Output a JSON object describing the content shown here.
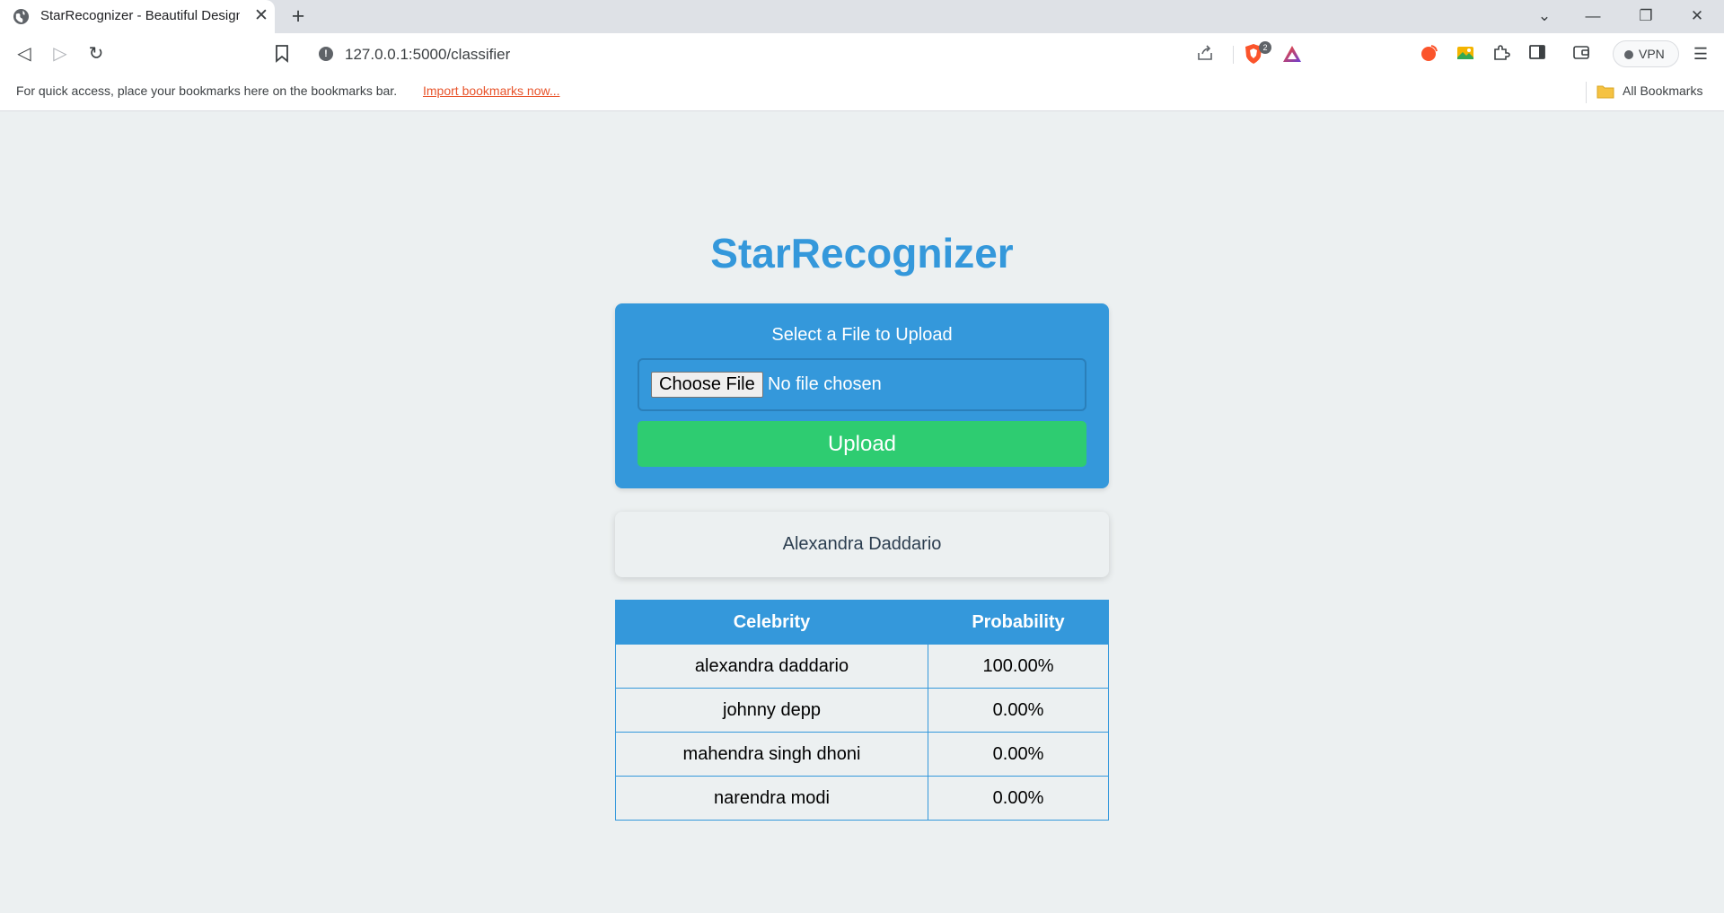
{
  "browser": {
    "tab_title": "StarRecognizer - Beautiful Design",
    "url": "127.0.0.1:5000/classifier",
    "shield_count": "2",
    "vpn_label": "VPN",
    "bookmarks_hint": "For quick access, place your bookmarks here on the bookmarks bar.",
    "import_link": "Import bookmarks now...",
    "all_bookmarks": "All Bookmarks"
  },
  "page": {
    "title": "StarRecognizer",
    "upload": {
      "label": "Select a File to Upload",
      "choose_button": "Choose File",
      "file_status": "No file chosen",
      "submit_label": "Upload"
    },
    "result_name": "Alexandra Daddario",
    "table": {
      "headers": [
        "Celebrity",
        "Probability"
      ],
      "rows": [
        [
          "alexandra daddario",
          "100.00%"
        ],
        [
          "johnny depp",
          "0.00%"
        ],
        [
          "mahendra singh dhoni",
          "0.00%"
        ],
        [
          "narendra modi",
          "0.00%"
        ]
      ]
    }
  },
  "colors": {
    "primary": "#3498db",
    "success": "#2ecc71",
    "background": "#ecf0f1",
    "text_dark": "#2c3e50"
  }
}
